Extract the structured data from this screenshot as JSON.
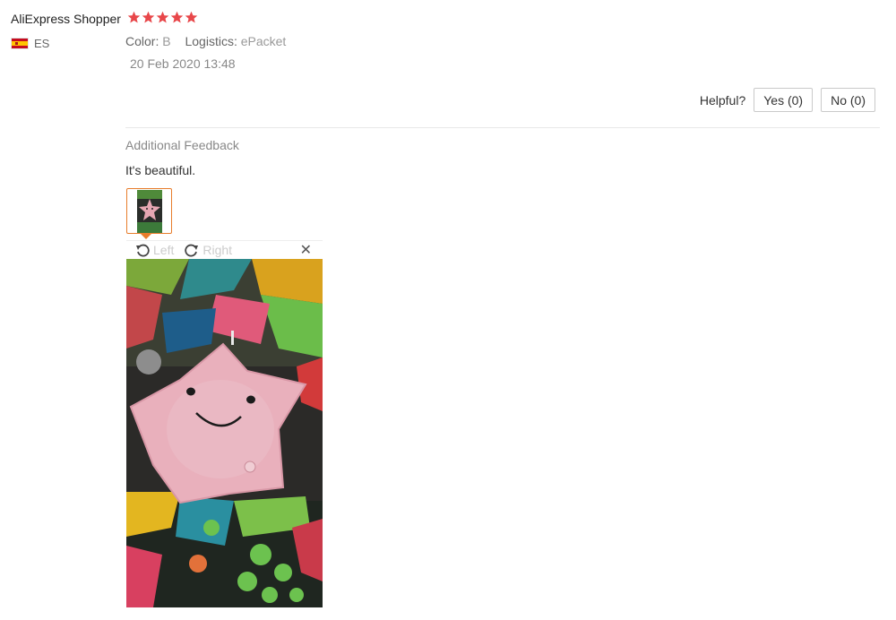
{
  "reviewer": {
    "name": "AliExpress Shopper",
    "country_code": "ES",
    "rating": 5
  },
  "colors": {
    "star": "#e8474a",
    "accent_orange": "#e87d2c"
  },
  "meta": {
    "color_label": "Color:",
    "color_value": "B",
    "logistics_label": "Logistics:",
    "logistics_value": "ePacket",
    "date": "20 Feb 2020 13:48"
  },
  "helpful": {
    "label": "Helpful?",
    "yes_label": "Yes (0)",
    "no_label": "No (0)"
  },
  "additional_feedback": {
    "title": "Additional Feedback",
    "text": "It's beautiful."
  },
  "image_viewer": {
    "rotate_left_label": "Left",
    "rotate_right_label": "Right",
    "close_icon": "close-icon"
  }
}
